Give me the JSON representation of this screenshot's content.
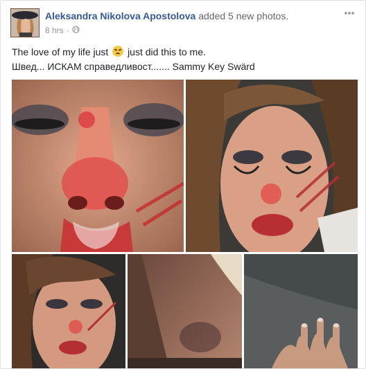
{
  "post": {
    "author": "Aleksandra Nikolova Apostolova",
    "action": "added 5 new photos.",
    "timestamp": "8 hrs",
    "privacy_icon": "globe-icon",
    "options_icon": "more-options-icon",
    "line1_before": "The love of my life just",
    "line1_after": "just did this to me.",
    "emoji": "crying-face-emoji",
    "line2": "Швед... ИСКАМ справедливост....... Sammy Key Swärd"
  },
  "photos": [
    {
      "name": "photo-1"
    },
    {
      "name": "photo-2"
    },
    {
      "name": "photo-3"
    },
    {
      "name": "photo-4"
    },
    {
      "name": "photo-5"
    }
  ],
  "colors": {
    "author_link": "#365899",
    "meta_text": "#90949c",
    "body_text": "#1d2129",
    "card_border": "#dddfe2"
  }
}
